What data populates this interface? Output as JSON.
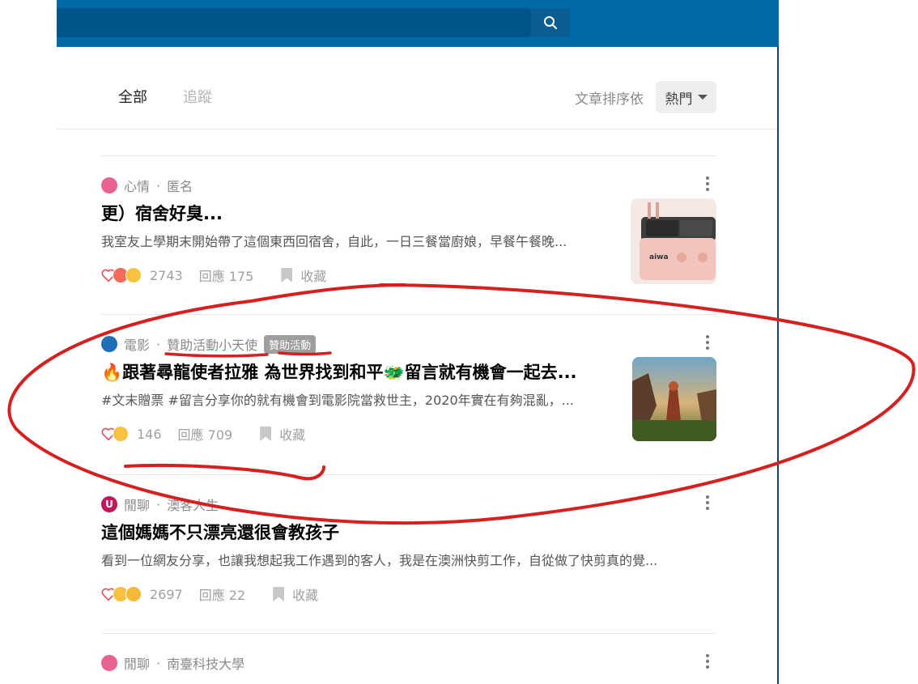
{
  "tabs": [
    {
      "label": "全部",
      "active": true
    },
    {
      "label": "追蹤",
      "active": false
    }
  ],
  "sort": {
    "label": "文章排序依",
    "value": "熱門"
  },
  "posts": [
    {
      "category": "心情",
      "author": "匿名",
      "title": "更）宿舍好臭...",
      "excerpt": "我室友上學期末開始帶了這個東西回宿舍，自此，一日三餐當廚娘，早餐午餐晚...",
      "likes": "2743",
      "replies": "回應 175",
      "bookmark": "收藏"
    },
    {
      "category": "電影",
      "author": "贊助活動小天使",
      "badge": "贊助活動",
      "title": "🔥跟著尋龍使者拉雅 為世界找到和平🐲留言就有機會一起去...",
      "excerpt": "#文末贈票 #留言分享你的就有機會到電影院當救世主，2020年實在有夠混亂，...",
      "likes": "146",
      "replies": "回應 709",
      "bookmark": "收藏"
    },
    {
      "category": "閒聊",
      "author": "澳客人生",
      "title": "這個媽媽不只漂亮還很會教孩子",
      "excerpt": "看到一位網友分享，也讓我想起我工作遇到的客人，我是在澳洲快剪工作，自從做了快剪真的覺...",
      "likes": "2697",
      "replies": "回應 22",
      "bookmark": "收藏"
    },
    {
      "category": "閒聊",
      "author": "南臺科技大學"
    }
  ],
  "thumb_brand": "aiwa",
  "colors": {
    "header": "#006aa6",
    "annotation": "#d61f1f",
    "badge": "#9e9e9e"
  }
}
